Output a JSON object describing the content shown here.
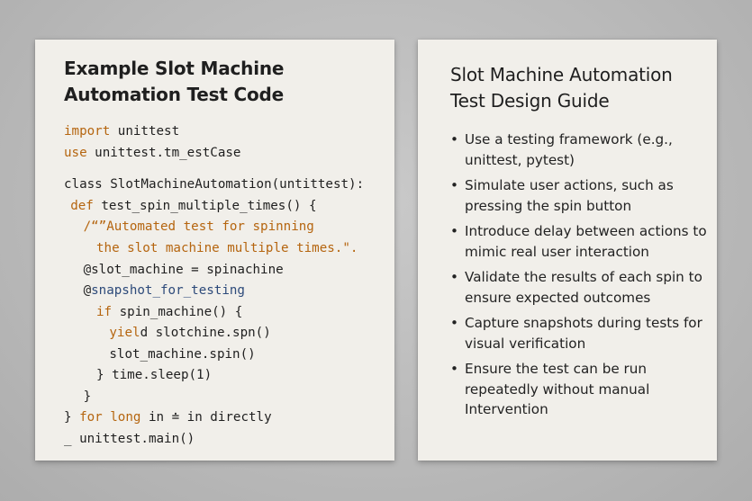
{
  "left_card": {
    "title": "Example Slot Machine Automation Test Code",
    "code_lines": [
      {
        "indent": 0,
        "parts": [
          {
            "t": "import",
            "c": "kw"
          },
          {
            "t": " unittest",
            "c": ""
          }
        ]
      },
      {
        "indent": 0,
        "parts": [
          {
            "t": "use",
            "c": "kw"
          },
          {
            "t": " unittest.tm_estCase",
            "c": ""
          }
        ]
      },
      {
        "indent": 0,
        "parts": [
          {
            "t": "class SlotMachineAutomation(untittest):",
            "c": ""
          }
        ]
      },
      {
        "indent": 1,
        "parts": [
          {
            "t": "def",
            "c": "kw"
          },
          {
            "t": " test_spin_multiple_times() {",
            "c": ""
          }
        ]
      },
      {
        "indent": 3,
        "parts": [
          {
            "t": "/“”Automated test for spinning",
            "c": "str"
          }
        ]
      },
      {
        "indent": 5,
        "parts": [
          {
            "t": "the slot machine multiple times.\".",
            "c": "str"
          }
        ]
      },
      {
        "indent": 3,
        "parts": [
          {
            "t": "@slot_machine = spinachine",
            "c": ""
          }
        ]
      },
      {
        "indent": 3,
        "parts": [
          {
            "t": "@",
            "c": ""
          },
          {
            "t": "snapshot_for_testing",
            "c": "deco"
          }
        ]
      },
      {
        "indent": 5,
        "parts": [
          {
            "t": "if",
            "c": "kw"
          },
          {
            "t": " spin_machine() {",
            "c": ""
          }
        ]
      },
      {
        "indent": 7,
        "parts": [
          {
            "t": "yiel",
            "c": "kw"
          },
          {
            "t": "d slotchine.spn()",
            "c": ""
          }
        ]
      },
      {
        "indent": 7,
        "parts": [
          {
            "t": "slot_machine.spin()",
            "c": ""
          }
        ]
      },
      {
        "indent": 5,
        "parts": [
          {
            "t": "} time.sleep(1)",
            "c": ""
          }
        ]
      },
      {
        "indent": 3,
        "parts": [
          {
            "t": "}",
            "c": ""
          }
        ]
      },
      {
        "indent": 0,
        "parts": [
          {
            "t": "} ",
            "c": ""
          },
          {
            "t": "for long",
            "c": "kw"
          },
          {
            "t": " in ≐ in directly",
            "c": ""
          }
        ]
      },
      {
        "indent": 0,
        "parts": [
          {
            "t": "_ unittest.main()",
            "c": ""
          }
        ]
      }
    ]
  },
  "right_card": {
    "title": "Slot Machine Automation Test Design Guide",
    "bullet_glyph": "•",
    "items": [
      "Use a testing framework (e.g., unittest, pytest)",
      "Simulate user actions, such as pressing the spin button",
      "Introduce delay between actions to mimic real user interaction",
      "Validate the results of each spin to ensure expected outcomes",
      "Capture snapshots during tests for visual verification",
      "Ensure the test can be run repeatedly without manual Intervention"
    ]
  }
}
